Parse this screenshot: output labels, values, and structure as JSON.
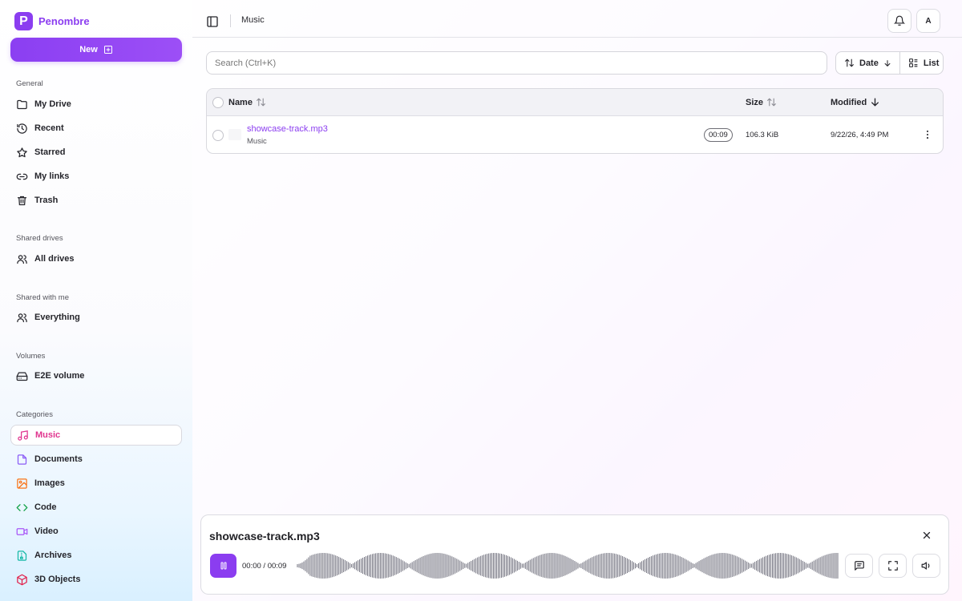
{
  "brand": {
    "name": "Penombre",
    "logo_letter": "P",
    "accent": "#8b3df0"
  },
  "sidebar": {
    "new_label": "New",
    "sections": [
      {
        "title": "General",
        "items": [
          {
            "label": "My Drive",
            "icon": "folder-icon"
          },
          {
            "label": "Recent",
            "icon": "clock-icon"
          },
          {
            "label": "Starred",
            "icon": "star-icon"
          },
          {
            "label": "My links",
            "icon": "link-icon"
          },
          {
            "label": "Trash",
            "icon": "trash-icon"
          }
        ]
      },
      {
        "title": "Shared drives",
        "items": [
          {
            "label": "All drives",
            "icon": "users-icon"
          }
        ]
      },
      {
        "title": "Shared with me",
        "items": [
          {
            "label": "Everything",
            "icon": "users-icon"
          }
        ]
      },
      {
        "title": "Volumes",
        "items": [
          {
            "label": "E2E volume",
            "icon": "hard-drive-icon"
          }
        ]
      },
      {
        "title": "Categories",
        "items": [
          {
            "label": "Music",
            "icon": "music-icon",
            "color": "#e0348e",
            "active": true
          },
          {
            "label": "Documents",
            "icon": "document-icon",
            "color": "#8b5cf6"
          },
          {
            "label": "Images",
            "icon": "image-icon",
            "color": "#f97316"
          },
          {
            "label": "Code",
            "icon": "code-icon",
            "color": "#16a34a"
          },
          {
            "label": "Video",
            "icon": "video-icon",
            "color": "#a855f7"
          },
          {
            "label": "Archives",
            "icon": "archive-icon",
            "color": "#14b8a6"
          },
          {
            "label": "3D Objects",
            "icon": "cube-icon",
            "color": "#e11d48"
          }
        ]
      }
    ]
  },
  "topbar": {
    "breadcrumb": "Music",
    "avatar_initial": "A"
  },
  "toolbar": {
    "search_placeholder": "Search (Ctrl+K)",
    "sort_label": "Date",
    "view_label": "List"
  },
  "table": {
    "columns": {
      "name": "Name",
      "size": "Size",
      "modified": "Modified"
    },
    "rows": [
      {
        "name": "showcase-track.mp3",
        "category": "Music",
        "duration": "00:09",
        "size": "106.3 KiB",
        "modified": "9/22/26, 4:49 PM"
      }
    ]
  },
  "player": {
    "title": "showcase-track.mp3",
    "time": "00:00 / 00:09"
  }
}
